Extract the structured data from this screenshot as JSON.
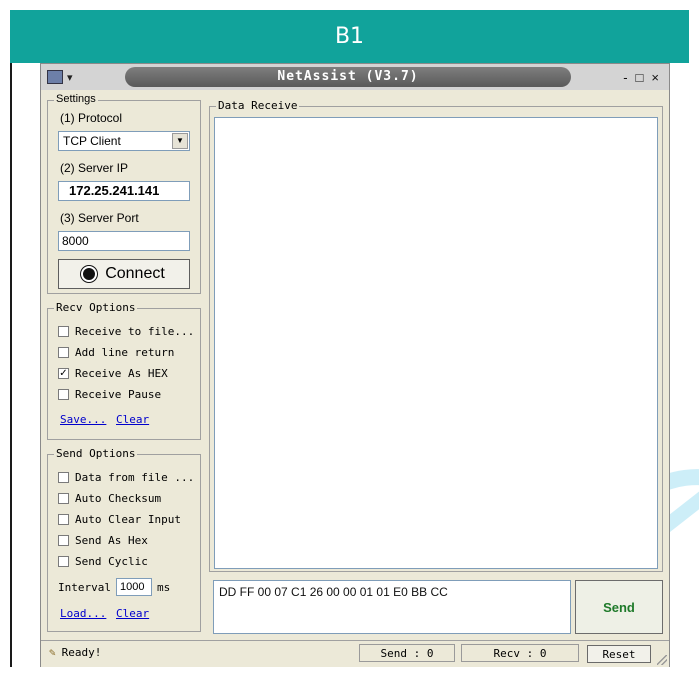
{
  "banner": {
    "title": "B1"
  },
  "window": {
    "title": "NetAssist (V3.7)",
    "controls": {
      "minimize": "-",
      "maximize": "□",
      "close": "×"
    }
  },
  "settings": {
    "group_title": "Settings",
    "protocol_label": "(1) Protocol",
    "protocol_value": "TCP Client",
    "server_ip_label": "(2) Server IP",
    "server_ip_value": "172.25.241.141",
    "server_port_label": "(3) Server Port",
    "server_port_value": "8000",
    "connect_label": "Connect"
  },
  "recv_options": {
    "group_title": "Recv Options",
    "items": [
      {
        "label": "Receive to file...",
        "checked": false
      },
      {
        "label": "Add line return",
        "checked": false
      },
      {
        "label": "Receive As HEX",
        "checked": true
      },
      {
        "label": "Receive Pause",
        "checked": false
      }
    ],
    "save_link": "Save...",
    "clear_link": "Clear"
  },
  "send_options": {
    "group_title": "Send Options",
    "items": [
      {
        "label": "Data from file ...",
        "checked": false
      },
      {
        "label": "Auto Checksum",
        "checked": false
      },
      {
        "label": "Auto Clear Input",
        "checked": false
      },
      {
        "label": "Send As Hex",
        "checked": false
      },
      {
        "label": "Send Cyclic",
        "checked": false
      }
    ],
    "interval_label": "Interval",
    "interval_value": "1000",
    "interval_unit": "ms",
    "load_link": "Load...",
    "clear_link": "Clear"
  },
  "data_receive": {
    "group_title": "Data Receive"
  },
  "send_area": {
    "text": "DD FF 00 07 C1 26 00 00 01 01 E0 BB CC",
    "send_label": "Send"
  },
  "status": {
    "ready_text": "Ready!",
    "send_count": "Send : 0",
    "recv_count": "Recv : 0",
    "reset_label": "Reset"
  },
  "colors": {
    "banner": "#11a39b",
    "send_button_text": "#1f7a2a"
  }
}
